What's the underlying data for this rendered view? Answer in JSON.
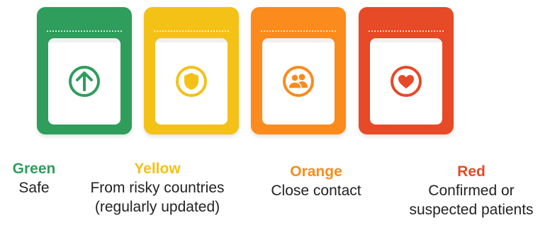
{
  "colors": {
    "green": "#2f9d5c",
    "yellow": "#f4c117",
    "orange": "#fb8b1c",
    "red": "#e64a26"
  },
  "cards": [
    {
      "icon": "arrow-up-circle-icon",
      "title": "Green",
      "desc": [
        "Safe"
      ]
    },
    {
      "icon": "shield-icon",
      "title": "Yellow",
      "desc": [
        "From risky countries",
        "(regularly updated)"
      ]
    },
    {
      "icon": "people-icon",
      "title": "Orange",
      "desc": [
        "Close contact"
      ]
    },
    {
      "icon": "heart-icon",
      "title": "Red",
      "desc": [
        "Confirmed or",
        "suspected patients"
      ]
    }
  ]
}
